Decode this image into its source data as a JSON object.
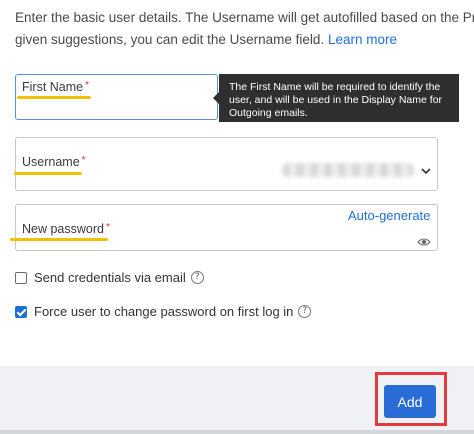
{
  "intro": {
    "line1": "Enter the basic user details. The Username will get autofilled based on the Preferred E",
    "line2": "given suggestions, you can edit the Username field.",
    "learn_more": "Learn more"
  },
  "form": {
    "first_name": {
      "label": "First Name",
      "required": "*",
      "value": ""
    },
    "username": {
      "label": "Username",
      "required": "*"
    },
    "password": {
      "label": "New password",
      "required": "*",
      "auto_generate": "Auto-generate"
    }
  },
  "tooltip": {
    "text": "The First Name will be required to identify the user, and will be used in the Display Name for Outgoing emails."
  },
  "options": {
    "send_credentials": {
      "label": "Send credentials via email",
      "checked": false
    },
    "force_change": {
      "label": "Force user to change password on first log in",
      "checked": true
    }
  },
  "footer": {
    "add_label": "Add"
  },
  "colors": {
    "accent": "#2a6cd6",
    "link": "#1f6fd6",
    "annotation_underline": "#f2c200",
    "annotation_box": "#e23b3b",
    "tooltip_bg": "#2d2f31"
  },
  "icons": {
    "chevron": "chevron-down-icon",
    "eye": "eye-icon",
    "help": "help-icon"
  }
}
